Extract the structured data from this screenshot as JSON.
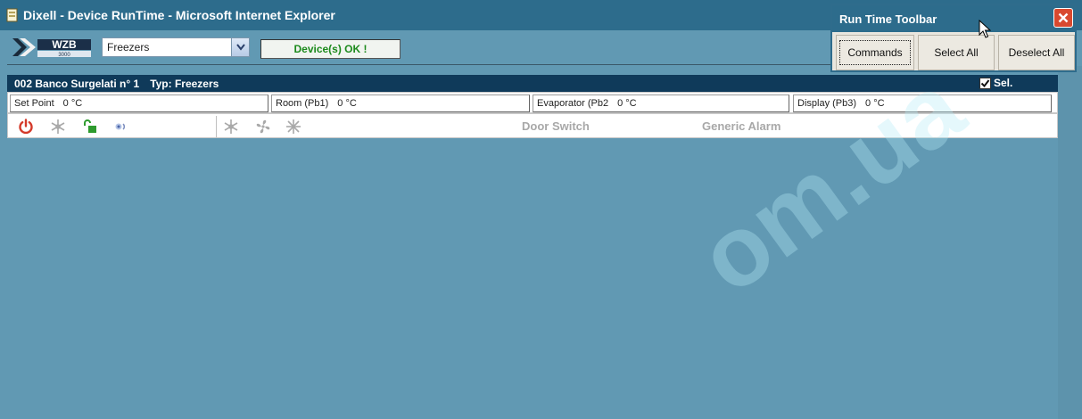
{
  "window": {
    "title": "Dixell - Device RunTime - Microsoft Internet Explorer"
  },
  "topbar": {
    "logo_icon": "wzb-3000-logo",
    "device_type_select": {
      "value": "Freezers"
    },
    "status_text": "Device(s) OK !"
  },
  "device": {
    "name": "002 Banco Surgelati n° 1",
    "type_label": "Typ: Freezers",
    "sel_label": "Sel.",
    "sel_checked": true,
    "readings": [
      {
        "label": "Set Point",
        "value": "0 °C"
      },
      {
        "label": "Room (Pb1)",
        "value": "0 °C"
      },
      {
        "label": "Evaporator (Pb2",
        "value": "0 °C"
      },
      {
        "label": "Display (Pb3)",
        "value": "0 °C"
      }
    ],
    "icons": [
      "power-icon",
      "snowflake-icon",
      "padlock-open-icon",
      "sensor-icon",
      "snowflake-icon",
      "fan-icon",
      "defrost-icon"
    ],
    "statuses": [
      "Door Switch",
      "Generic Alarm"
    ]
  },
  "toolbar": {
    "title": "Run Time Toolbar",
    "buttons": [
      "Commands",
      "Select All",
      "Deselect All"
    ]
  },
  "watermark": {
    "text": "om.ua"
  },
  "colors": {
    "background": "#6199b3",
    "titlebar": "#2d6c8c",
    "device_header": "#0f3a5a",
    "status_ok": "#1c8a1c",
    "power_icon": "#d43a2a",
    "lock_icon": "#2e9b2e"
  }
}
